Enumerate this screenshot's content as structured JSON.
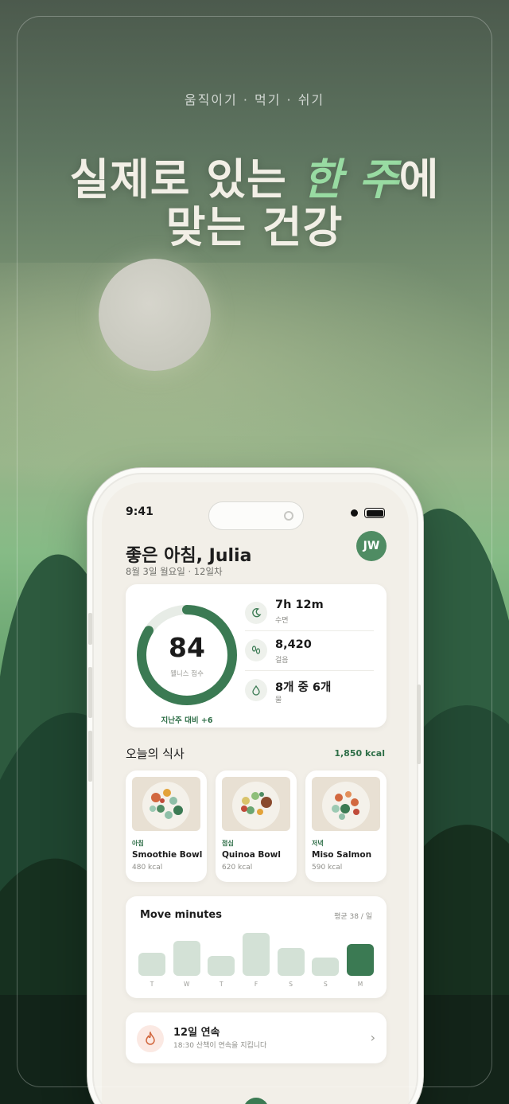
{
  "hero": {
    "tagline": "움직이기 · 먹기 · 쉬기",
    "headline_part1": "실제로 있는 ",
    "headline_accent": "한 주",
    "headline_part2": "에",
    "headline_line2": "맞는 건강"
  },
  "status_bar": {
    "time": "9:41"
  },
  "header": {
    "greeting": "좋은 아침, Julia",
    "date": "8월 3일 월요일 · 12일차",
    "avatar_initials": "JW"
  },
  "wellness": {
    "score": "84",
    "score_fraction": 0.84,
    "label": "웰니스 점수",
    "delta": "지난주 대비 +6",
    "metrics": [
      {
        "icon": "moon-icon",
        "value": "7h 12m",
        "label": "수면"
      },
      {
        "icon": "footsteps-icon",
        "value": "8,420",
        "label": "걸음"
      },
      {
        "icon": "water-drop-icon",
        "value": "8개 중 6개",
        "label": "물"
      }
    ]
  },
  "meals": {
    "title": "오늘의 식사",
    "total": "1,850 kcal",
    "items": [
      {
        "type": "아침",
        "name": "Smoothie Bowl",
        "kcal": "480 kcal"
      },
      {
        "type": "점심",
        "name": "Quinoa Bowl",
        "kcal": "620 kcal"
      },
      {
        "type": "저녁",
        "name": "Miso Salmon",
        "kcal": "590 kcal"
      }
    ]
  },
  "move": {
    "title": "Move minutes",
    "average": "평균 38 / 일",
    "chart_data": {
      "type": "bar",
      "categories": [
        "T",
        "W",
        "T",
        "F",
        "S",
        "S",
        "M"
      ],
      "values": [
        30,
        45,
        25,
        55,
        36,
        23,
        41
      ],
      "highlight_index": 6,
      "colors": {
        "default": "#d3e1d6",
        "highlight": "#3b7a53"
      }
    }
  },
  "streak": {
    "title": "12일 연속",
    "subtitle": "18:30 산책이 연속을 지킵니다",
    "icon": "flame-icon"
  },
  "colors": {
    "accent": "#3b7a53",
    "accent_text": "#2f6f48",
    "headline_accent": "#98dba2"
  }
}
